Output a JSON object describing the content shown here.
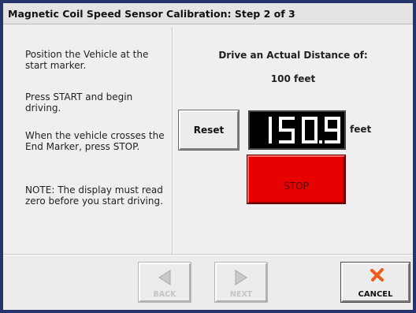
{
  "window": {
    "title": "Magnetic Coil Speed Sensor Calibration:  Step 2 of 3"
  },
  "instructions": {
    "step1": "Position the Vehicle at the start marker.",
    "step2": "Press START and begin driving.",
    "step3": "When the vehicle crosses the End Marker, press STOP.",
    "note": "NOTE:  The display must read zero before you start driving."
  },
  "target": {
    "label": "Drive an Actual Distance of:",
    "distance": "100 feet"
  },
  "controls": {
    "reset_label": "Reset",
    "display_value": "150.9",
    "unit_label": "feet",
    "stop_label": "STOP",
    "stop_color": "#e60000"
  },
  "footer": {
    "back_label": "BACK",
    "next_label": "NEXT",
    "cancel_label": "CANCEL",
    "back_icon": "left-arrow-icon",
    "next_icon": "right-arrow-icon",
    "cancel_icon": "red-x-icon"
  }
}
